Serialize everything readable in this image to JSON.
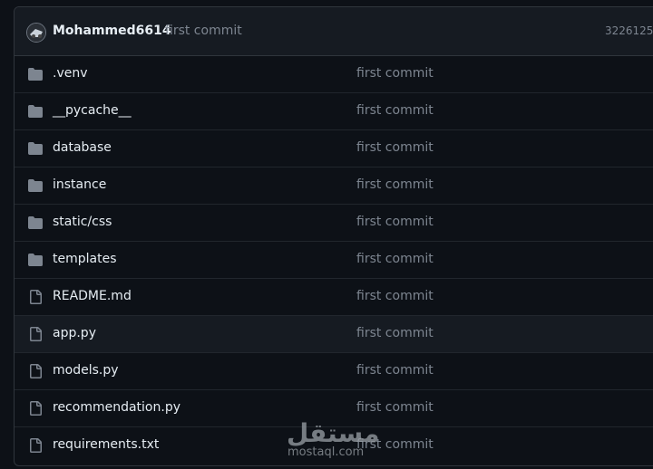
{
  "commit_header": {
    "author": "Mohammed6614",
    "message": "first commit",
    "hash": "3226125 ·"
  },
  "files": [
    {
      "name": ".venv",
      "type": "folder",
      "commit": "first commit"
    },
    {
      "name": "__pycache__",
      "type": "folder",
      "commit": "first commit"
    },
    {
      "name": "database",
      "type": "folder",
      "commit": "first commit"
    },
    {
      "name": "instance",
      "type": "folder",
      "commit": "first commit"
    },
    {
      "name": "static/css",
      "type": "folder",
      "commit": "first commit"
    },
    {
      "name": "templates",
      "type": "folder",
      "commit": "first commit"
    },
    {
      "name": "README.md",
      "type": "file",
      "commit": "first commit"
    },
    {
      "name": "app.py",
      "type": "file",
      "commit": "first commit"
    },
    {
      "name": "models.py",
      "type": "file",
      "commit": "first commit"
    },
    {
      "name": "recommendation.py",
      "type": "file",
      "commit": "first commit"
    },
    {
      "name": "requirements.txt",
      "type": "file",
      "commit": "first commit"
    }
  ],
  "icons": {
    "folder": "folder-icon",
    "file": "file-icon"
  },
  "colors": {
    "background": "#0d1117",
    "header": "#161b22",
    "border": "#30363d",
    "text": "#e6edf3",
    "muted": "#7d8590",
    "icon": "#7d8590"
  },
  "watermark": {
    "arabic": "مستقل",
    "latin": "mostaql.com"
  }
}
